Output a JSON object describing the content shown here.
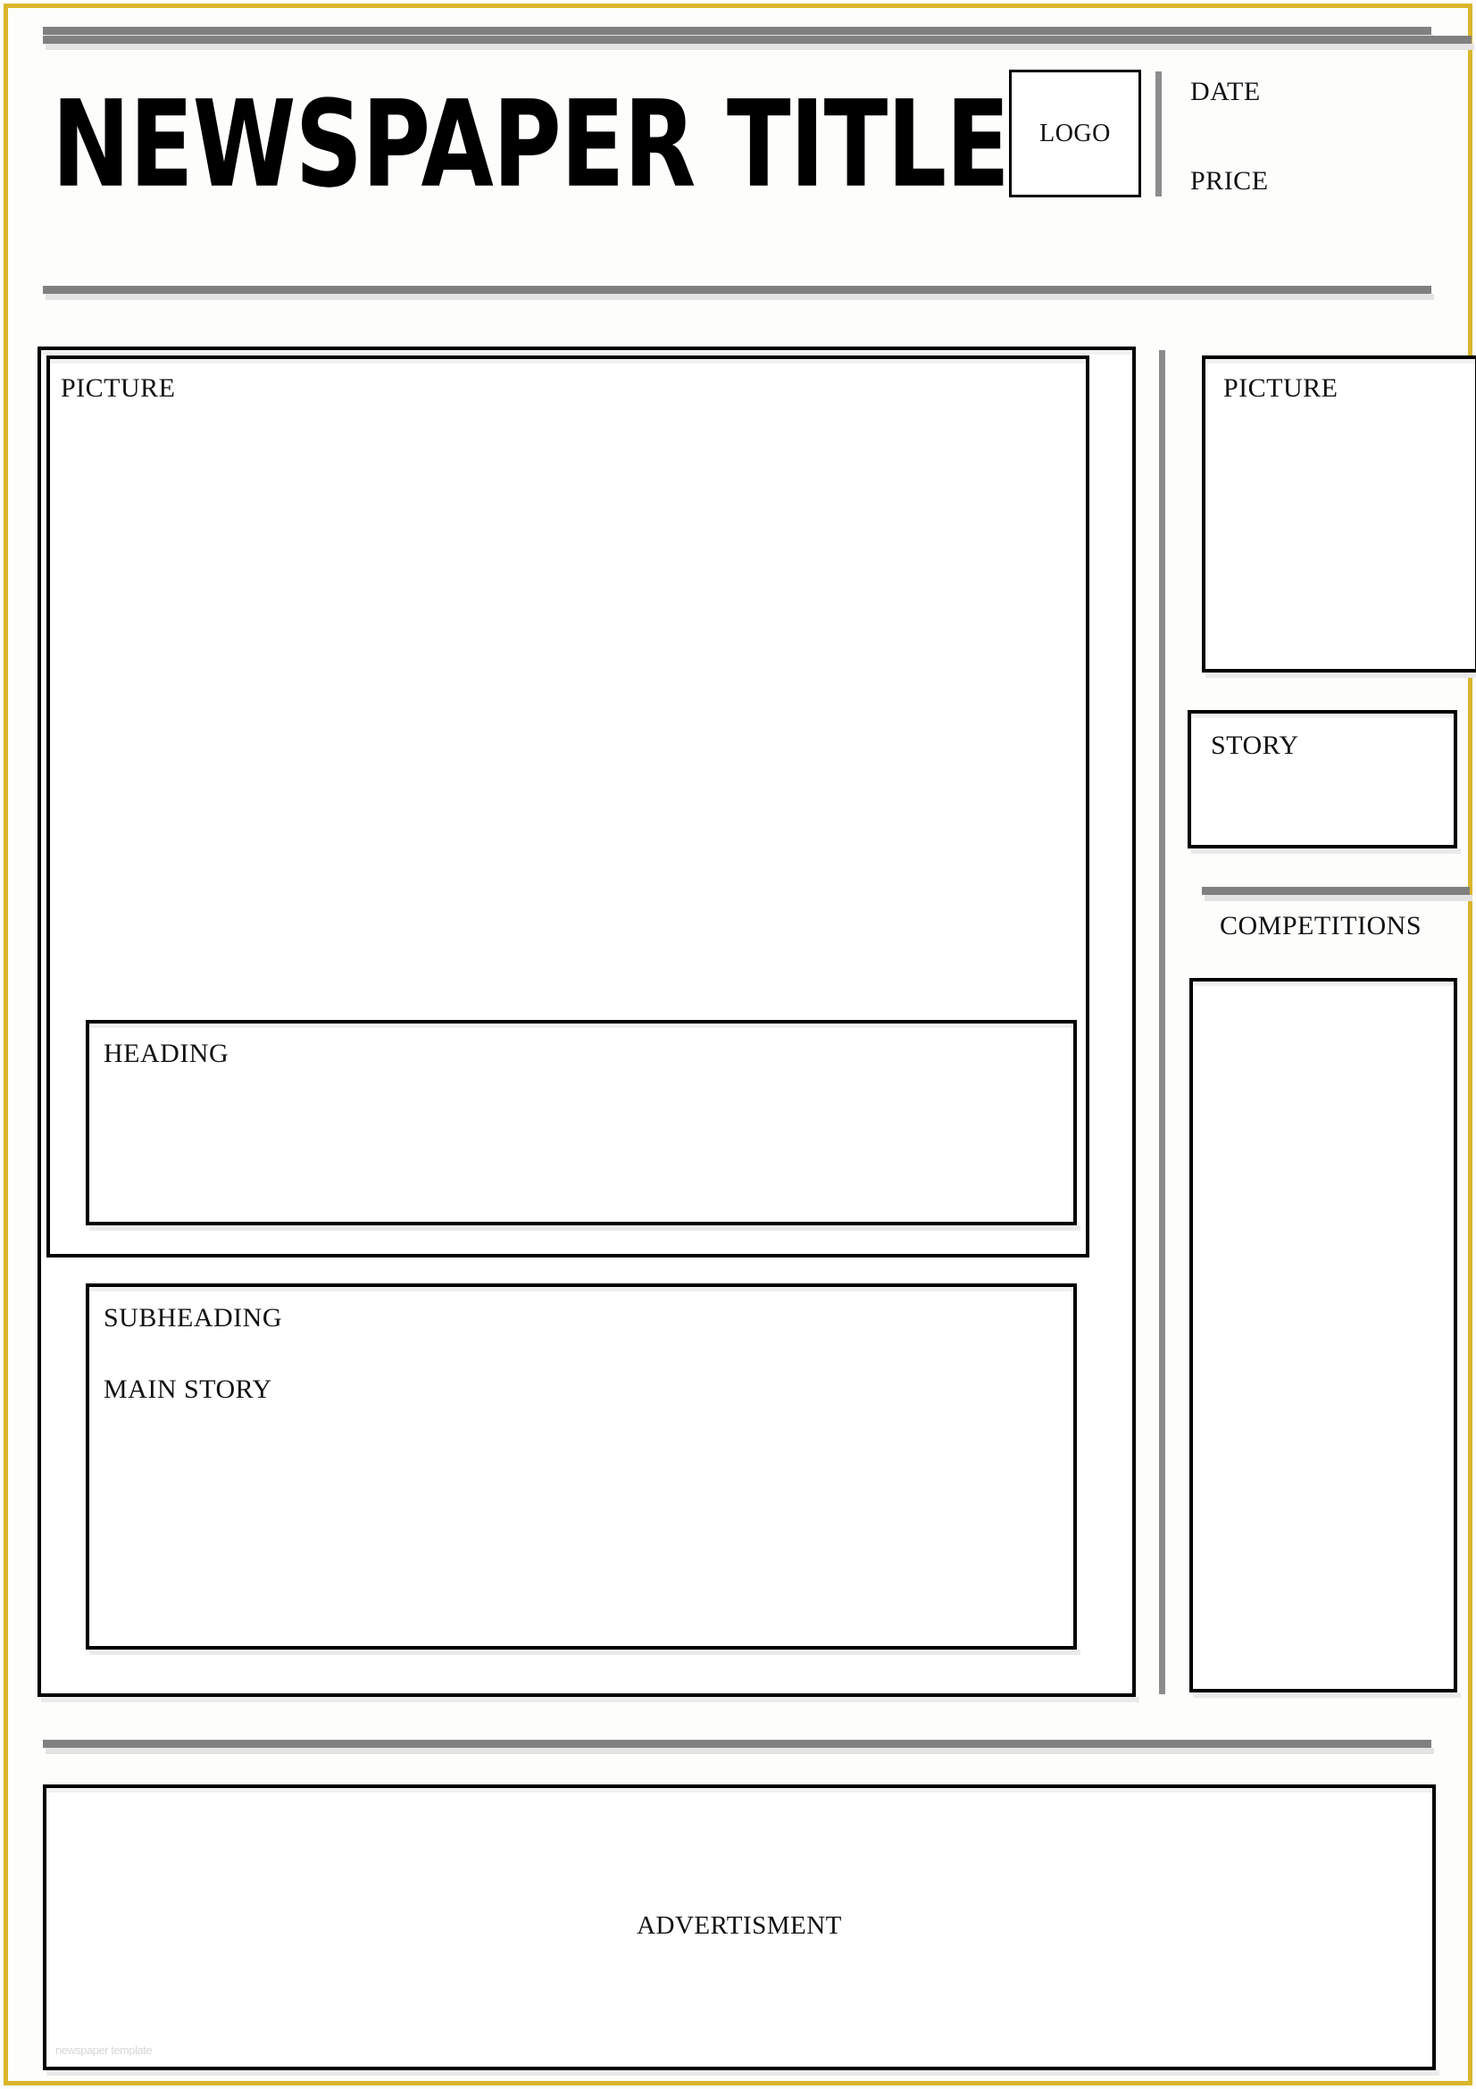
{
  "page": {
    "title": "Newspaper Template",
    "border_color": "#d9b62c",
    "rule_color": "#808080",
    "box_border_color": "#000000"
  },
  "masthead": {
    "title": "NEWSPAPER TITLE",
    "logo_label": "LOGO",
    "date_label": "DATE",
    "price_label": "PRICE"
  },
  "main": {
    "picture_label": "PICTURE",
    "heading_label": "HEADING",
    "subheading_label": "SUBHEADING",
    "main_story_label": "MAIN STORY"
  },
  "sidebar": {
    "picture_label": "PICTURE",
    "story_label": "STORY",
    "competitions_label": "COMPETITIONS"
  },
  "footer": {
    "advertisement_label": "ADVERTISMENT",
    "artifact_text": "newspaper template"
  }
}
